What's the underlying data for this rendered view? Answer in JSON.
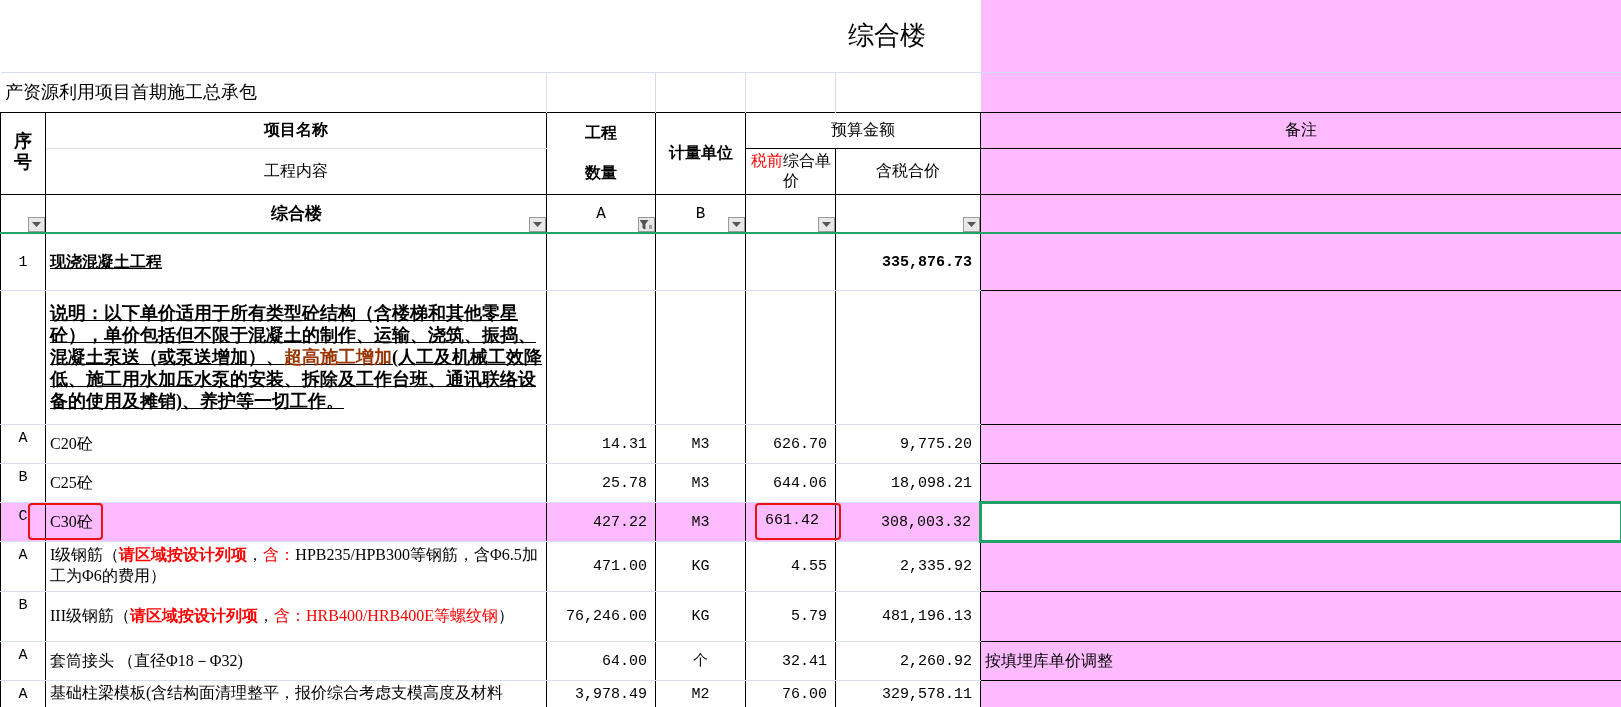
{
  "title": "综合楼",
  "subtitle": "产资源利用项目首期施工总承包",
  "header": {
    "seq": "序号",
    "name": "项目名称",
    "content": "工程内容",
    "qty": [
      "工程",
      "数量"
    ],
    "unit": "计量单位",
    "budget": "预算金额",
    "unit_price": [
      {
        "text": "税前",
        "color": "#ff0000"
      },
      {
        "text": "综合单价"
      }
    ],
    "total": "含税合价",
    "remark": "备注"
  },
  "filters": [
    {
      "filtered": false
    },
    {
      "label": "综合楼",
      "filtered": false
    },
    {
      "label": "A",
      "filtered": true
    },
    {
      "label": "B",
      "filtered": false
    },
    {
      "filtered": false
    },
    {
      "filtered": false
    }
  ],
  "rows": [
    {
      "kind": "section",
      "seq": "1",
      "name": [
        {
          "text": "现浇混凝土工程"
        }
      ],
      "total": "335,876.73"
    },
    {
      "kind": "note",
      "name": [
        {
          "text": "说明：以下单价适用于所有类型砼结构（含楼梯和其他零星砼），单价包括但不限于混凝土的制作、运输、浇筑、振捣、混凝土泵送（或泵送增加）、"
        },
        {
          "text": "超高施工增加",
          "color": "#993300"
        },
        {
          "text": "(人工及机械工效降低、施工用水加压水泵的安装、拆除及工作台班、通讯联络设备的使用及摊销)、养护等一切工作。"
        }
      ]
    },
    {
      "kind": "item",
      "seq": "A",
      "name": [
        {
          "text": "C20砼"
        }
      ],
      "qty": "14.31",
      "unit": "M3",
      "price": "626.70",
      "total": "9,775.20",
      "highlighted": false,
      "name_boxed": false,
      "price_boxed": false,
      "remark_selected": false
    },
    {
      "kind": "item",
      "seq": "B",
      "name": [
        {
          "text": "C25砼"
        }
      ],
      "qty": "25.78",
      "unit": "M3",
      "price": "644.06",
      "total": "18,098.21",
      "highlighted": false,
      "name_boxed": false,
      "price_boxed": false,
      "remark_selected": false
    },
    {
      "kind": "item",
      "seq": "C",
      "name": [
        {
          "text": "C30砼"
        }
      ],
      "qty": "427.22",
      "unit": "M3",
      "price": "661.42",
      "total": "308,003.32",
      "highlighted": true,
      "name_boxed": true,
      "price_boxed": true,
      "remark_selected": true
    },
    {
      "kind": "item",
      "seq": "A",
      "name": [
        {
          "text": "I级钢筋（"
        },
        {
          "text": "请区域按设计列项",
          "color": "#ff0000",
          "bold": true
        },
        {
          "text": "，"
        },
        {
          "text": "含：",
          "color": "#ff0000"
        },
        {
          "text": "HPB235/HPB300等钢筋，含Φ6.5加工为Φ6的费用）"
        }
      ],
      "qty": "471.00",
      "unit": "KG",
      "price": "4.55",
      "total": "2,335.92",
      "highlighted": false,
      "name_boxed": false,
      "price_boxed": false,
      "remark_selected": false
    },
    {
      "kind": "item",
      "seq": "B",
      "name": [
        {
          "text": "III级钢筋（"
        },
        {
          "text": "请区域按设计列项",
          "color": "#ff0000",
          "bold": true
        },
        {
          "text": "，"
        },
        {
          "text": "含：HRB400/HRB400E等螺纹钢",
          "color": "#ff0000"
        },
        {
          "text": "）"
        }
      ],
      "qty": "76,246.00",
      "unit": "KG",
      "price": "5.79",
      "total": "481,196.13",
      "highlighted": false,
      "name_boxed": false,
      "price_boxed": false,
      "remark_selected": false
    },
    {
      "kind": "item",
      "seq": "A",
      "name": [
        {
          "text": "套筒接头  （直径Φ18－Φ32)"
        }
      ],
      "qty": "64.00",
      "unit": "个",
      "price": "32.41",
      "total": "2,260.92",
      "remark": "按填埋库单价调整",
      "highlighted": false,
      "name_boxed": false,
      "price_boxed": false,
      "remark_selected": false
    },
    {
      "kind": "item",
      "seq": "A",
      "name": [
        {
          "text": "基础柱梁模板(含结构面清理整平，报价综合考虑支模高度及材料"
        }
      ],
      "qty": "3,978.49",
      "unit": "M2",
      "price": "76.00",
      "total": "329,578.11",
      "highlighted": false,
      "name_boxed": false,
      "price_boxed": false,
      "remark_selected": false
    }
  ]
}
